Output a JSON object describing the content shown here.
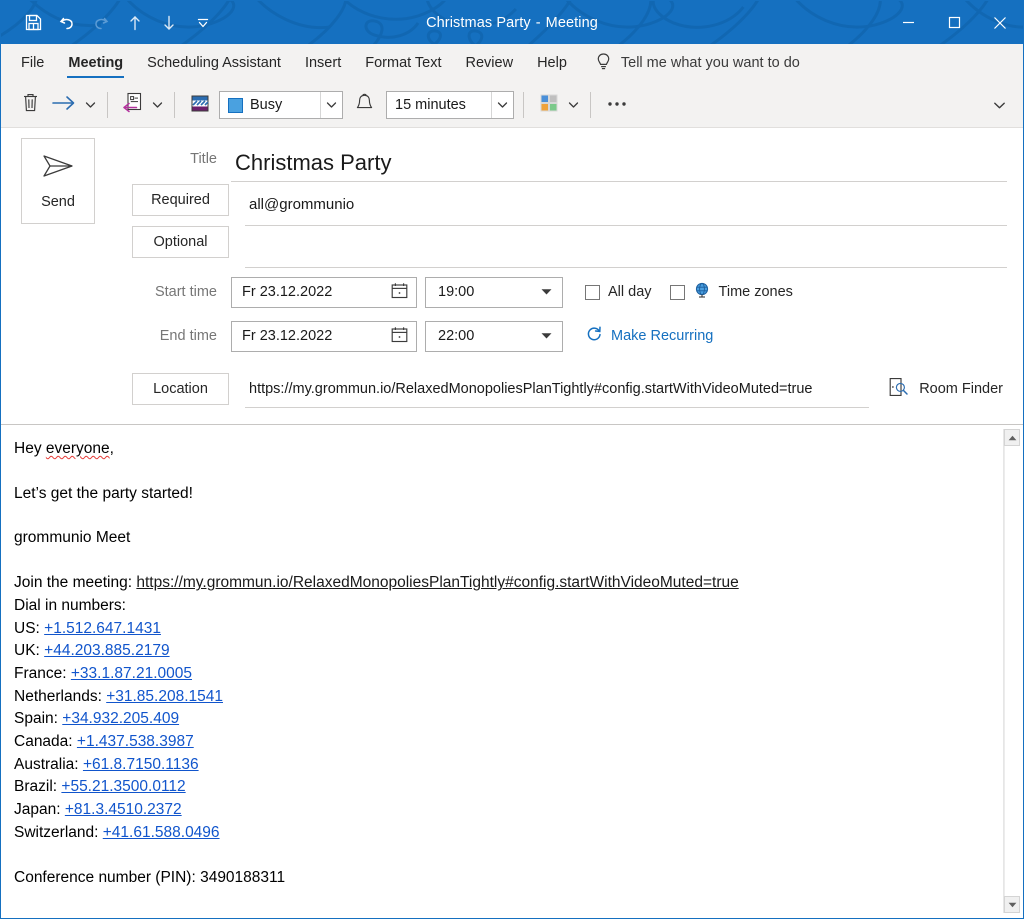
{
  "window": {
    "title": "Christmas Party",
    "separator": "-",
    "subtitle": "Meeting",
    "accent_color": "#1570c0",
    "link_color": "#1155cc"
  },
  "quick_access": [
    {
      "name": "save-icon",
      "label": "Save",
      "enabled": true
    },
    {
      "name": "undo-icon",
      "label": "Undo",
      "enabled": true
    },
    {
      "name": "redo-icon",
      "label": "Redo",
      "enabled": false
    },
    {
      "name": "previous-item-icon",
      "label": "Previous Item",
      "enabled": true
    },
    {
      "name": "next-item-icon",
      "label": "Next Item",
      "enabled": true
    },
    {
      "name": "customize-quick-access-icon",
      "label": "Customize Quick Access Toolbar",
      "enabled": true
    }
  ],
  "window_controls": {
    "minimize": "Minimize",
    "maximize": "Maximize",
    "close": "Close"
  },
  "ribbon": {
    "tabs": [
      {
        "label": "File",
        "active": false
      },
      {
        "label": "Meeting",
        "active": true
      },
      {
        "label": "Scheduling Assistant",
        "active": false
      },
      {
        "label": "Insert",
        "active": false
      },
      {
        "label": "Format Text",
        "active": false
      },
      {
        "label": "Review",
        "active": false
      },
      {
        "label": "Help",
        "active": false
      }
    ],
    "tell_me": "Tell me what you want to do",
    "tell_me_icon": "lightbulb-icon",
    "commands": {
      "delete_icon": "trash-icon",
      "forward_icon": "forward-arrow-icon",
      "response_options_icon": "response-options-icon",
      "show_as_icon": "show-as-icon",
      "show_as_value": "Busy",
      "show_as_swatch_color": "#4aa1e0",
      "reminder_icon": "bell-icon",
      "reminder_value": "15 minutes",
      "categorize_icon": "categorize-icon",
      "more_icon": "more-options-icon"
    },
    "collapse_icon": "chevron-down-icon"
  },
  "form": {
    "send_button": "Send",
    "send_icon": "send-arrow-icon",
    "title_label": "Title",
    "title_value": "Christmas Party",
    "required_label": "Required",
    "required_value": "all@grommunio",
    "optional_label": "Optional",
    "optional_value": "",
    "start_time_label": "Start time",
    "start_date": "Fr 23.12.2022",
    "start_time": "19:00",
    "end_time_label": "End time",
    "end_date": "Fr 23.12.2022",
    "end_time": "22:00",
    "calendar_icon": "calendar-icon",
    "dropdown_icon": "dropdown-arrow-icon",
    "all_day_label": "All day",
    "all_day_checked": false,
    "time_zones_label": "Time zones",
    "time_zones_checked": false,
    "time_zones_icon": "globe-icon",
    "make_recurring_label": "Make Recurring",
    "make_recurring_icon": "recurrence-icon",
    "location_label": "Location",
    "location_value": "https://my.grommun.io/RelaxedMonopoliesPlanTightly#config.startWithVideoMuted=true",
    "room_finder_label": "Room Finder",
    "room_finder_icon": "room-finder-icon"
  },
  "body": {
    "greeting": "Hey everyone,",
    "greeting_misspelled_word": "everyone",
    "line_party": "Let’s get the party started!",
    "line_product": "grommunio Meet",
    "join_prefix": "Join the meeting: ",
    "join_url": "https://my.grommun.io/RelaxedMonopoliesPlanTightly#config.startWithVideoMuted=true",
    "dial_in_header": "Dial in numbers:",
    "dial_in": [
      {
        "country": "US:",
        "number": "+1.512.647.1431"
      },
      {
        "country": "UK:",
        "number": "+44.203.885.2179"
      },
      {
        "country": "France:",
        "number": "+33.1.87.21.0005"
      },
      {
        "country": "Netherlands:",
        "number": "+31.85.208.1541"
      },
      {
        "country": "Spain:",
        "number": "+34.932.205.409"
      },
      {
        "country": "Canada:",
        "number": "+1.437.538.3987"
      },
      {
        "country": "Australia:",
        "number": "+61.8.7150.1136"
      },
      {
        "country": "Brazil:",
        "number": "+55.21.3500.0112"
      },
      {
        "country": "Japan:",
        "number": "+81.3.4510.2372"
      },
      {
        "country": "Switzerland:",
        "number": "+41.61.588.0496"
      }
    ],
    "conference_pin": "Conference number (PIN): 3490188311"
  },
  "scrollbar": {
    "up_icon": "scroll-up-arrow-icon",
    "down_icon": "scroll-down-arrow-icon"
  }
}
